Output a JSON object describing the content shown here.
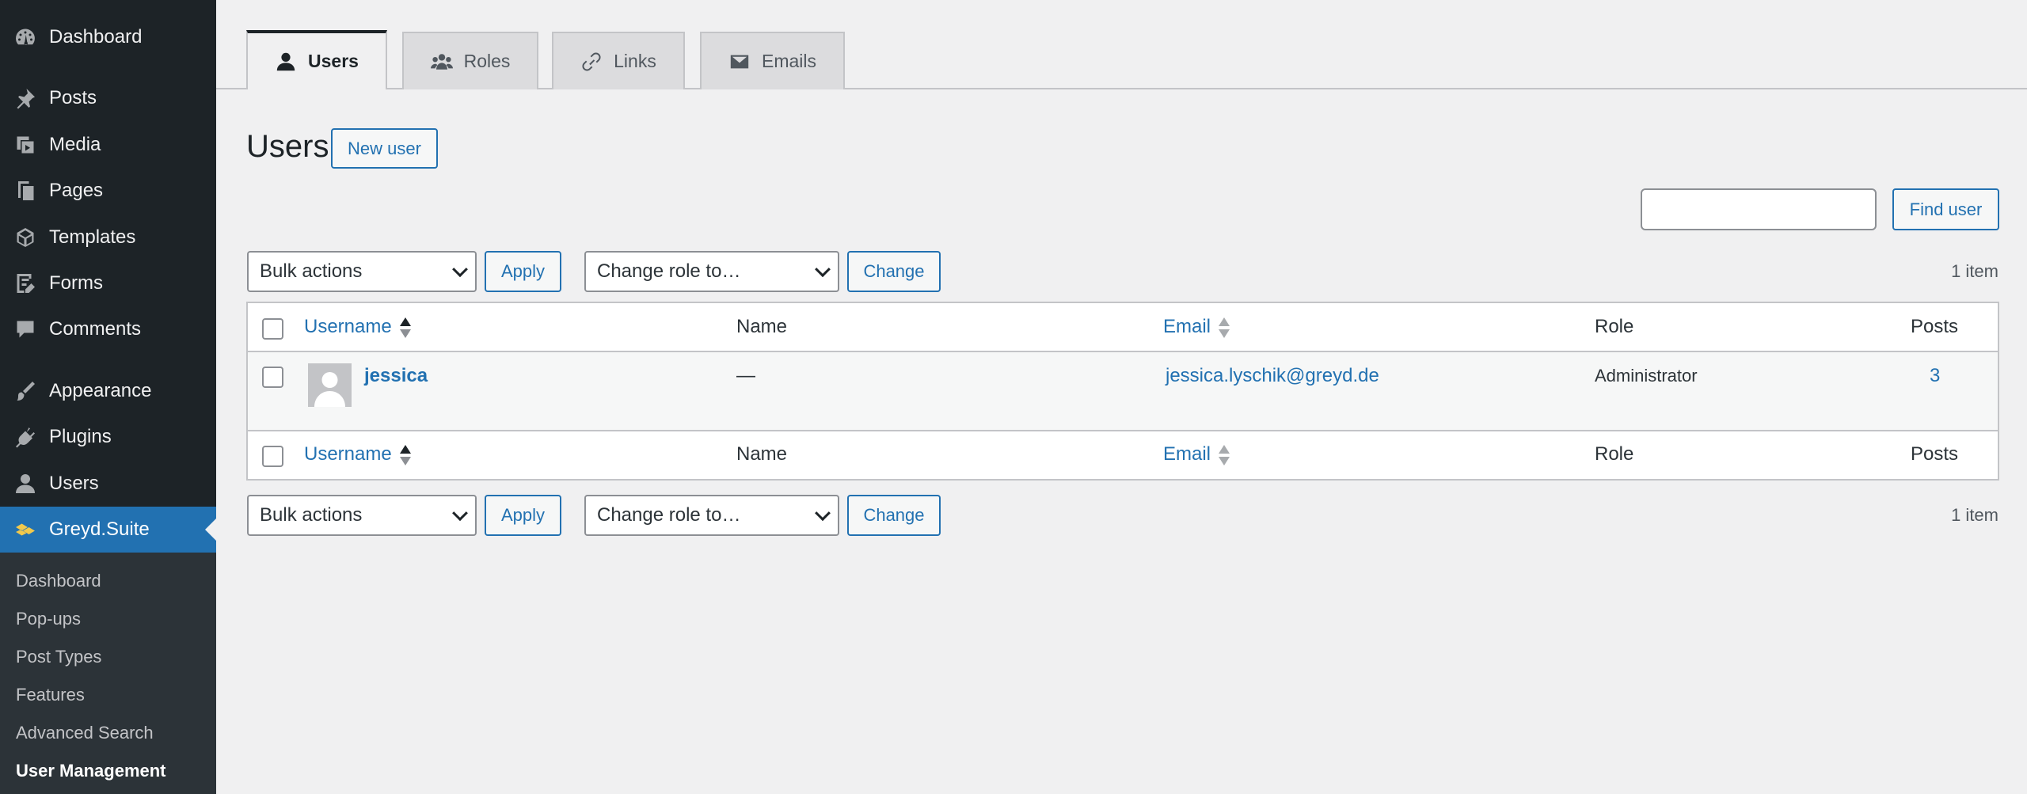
{
  "sidebar": {
    "items": [
      {
        "label": "Dashboard",
        "icon": "dashboard-icon"
      },
      {
        "label": "Posts",
        "icon": "pin-icon"
      },
      {
        "label": "Media",
        "icon": "media-icon"
      },
      {
        "label": "Pages",
        "icon": "pages-icon"
      },
      {
        "label": "Templates",
        "icon": "cube-icon"
      },
      {
        "label": "Forms",
        "icon": "forms-icon"
      },
      {
        "label": "Comments",
        "icon": "comment-icon"
      },
      {
        "label": "Appearance",
        "icon": "brush-icon"
      },
      {
        "label": "Plugins",
        "icon": "plug-icon"
      },
      {
        "label": "Users",
        "icon": "user-icon"
      },
      {
        "label": "Greyd.Suite",
        "icon": "greyd-logo-icon"
      }
    ],
    "submenu": [
      "Dashboard",
      "Pop-ups",
      "Post Types",
      "Features",
      "Advanced Search",
      "User Management"
    ]
  },
  "tabs": [
    {
      "label": "Users",
      "icon": "user-icon"
    },
    {
      "label": "Roles",
      "icon": "group-icon"
    },
    {
      "label": "Links",
      "icon": "link-icon"
    },
    {
      "label": "Emails",
      "icon": "envelope-icon"
    }
  ],
  "header": {
    "title": "Users",
    "new_user_label": "New user"
  },
  "search": {
    "value": "",
    "button_label": "Find user"
  },
  "top_nav": {
    "bulk_actions": "Bulk actions",
    "apply_label": "Apply",
    "change_role": "Change role to…",
    "change_label": "Change",
    "count": "1 item"
  },
  "bottom_nav": {
    "bulk_actions": "Bulk actions",
    "apply_label": "Apply",
    "change_role": "Change role to…",
    "change_label": "Change",
    "count": "1 item"
  },
  "table": {
    "columns": {
      "username": "Username",
      "name": "Name",
      "email": "Email",
      "role": "Role",
      "posts": "Posts"
    },
    "rows": [
      {
        "username": "jessica",
        "name": "—",
        "email": "jessica.lyschik@greyd.de",
        "role": "Administrator",
        "posts": "3"
      }
    ]
  },
  "colors": {
    "sidebar_bg": "#1d2327",
    "accent": "#2271b1",
    "submenu_bg": "#2c3338",
    "page_bg": "#f0f0f1"
  }
}
